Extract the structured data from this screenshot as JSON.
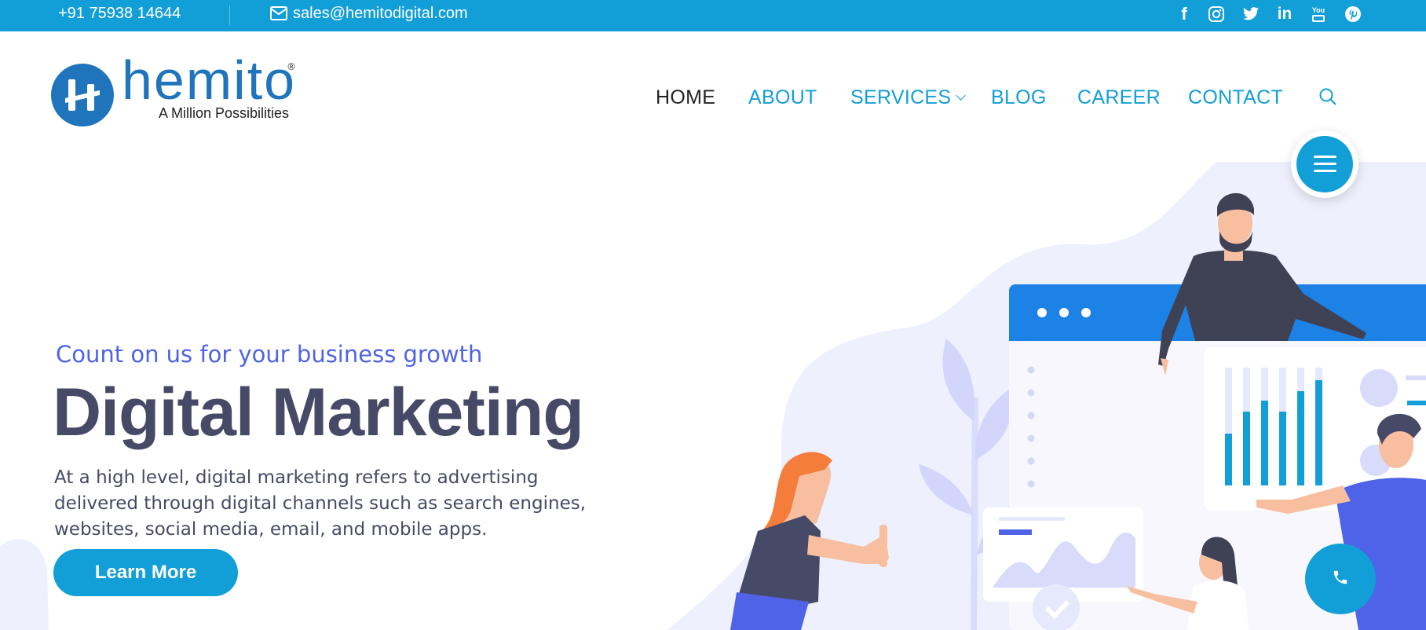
{
  "topbar": {
    "phone": "+91 75938 14644",
    "email": "sales@hemitodigital.com",
    "social_icons": [
      "facebook-icon",
      "instagram-icon",
      "twitter-icon",
      "linkedin-icon",
      "youtube-icon",
      "pinterest-icon"
    ],
    "linkedin_text": "in",
    "youtube_text": "You",
    "facebook_text": "f"
  },
  "header": {
    "logo": {
      "wordmark": "hemito",
      "registered": "®",
      "tagline": "A Million Possibilities"
    },
    "nav": [
      "HOME",
      "ABOUT",
      "SERVICES",
      "BLOG",
      "CAREER",
      "CONTACT"
    ],
    "active_nav": "HOME"
  },
  "hero": {
    "kicker": "Count on us for your business growth",
    "title": "Digital Marketing",
    "description": "At a high level, digital marketing refers to advertising delivered through digital channels such as search engines, websites, social media, email, and mobile apps.",
    "cta": "Learn More"
  },
  "colors": {
    "brand_blue": "#129ed7",
    "logo_blue": "#1f74bc",
    "accent_indigo": "#4f63e8",
    "heading": "#474a66"
  },
  "icons": {
    "email": "envelope-icon",
    "search": "search-icon",
    "menu": "hamburger-icon",
    "call": "phone-icon"
  }
}
